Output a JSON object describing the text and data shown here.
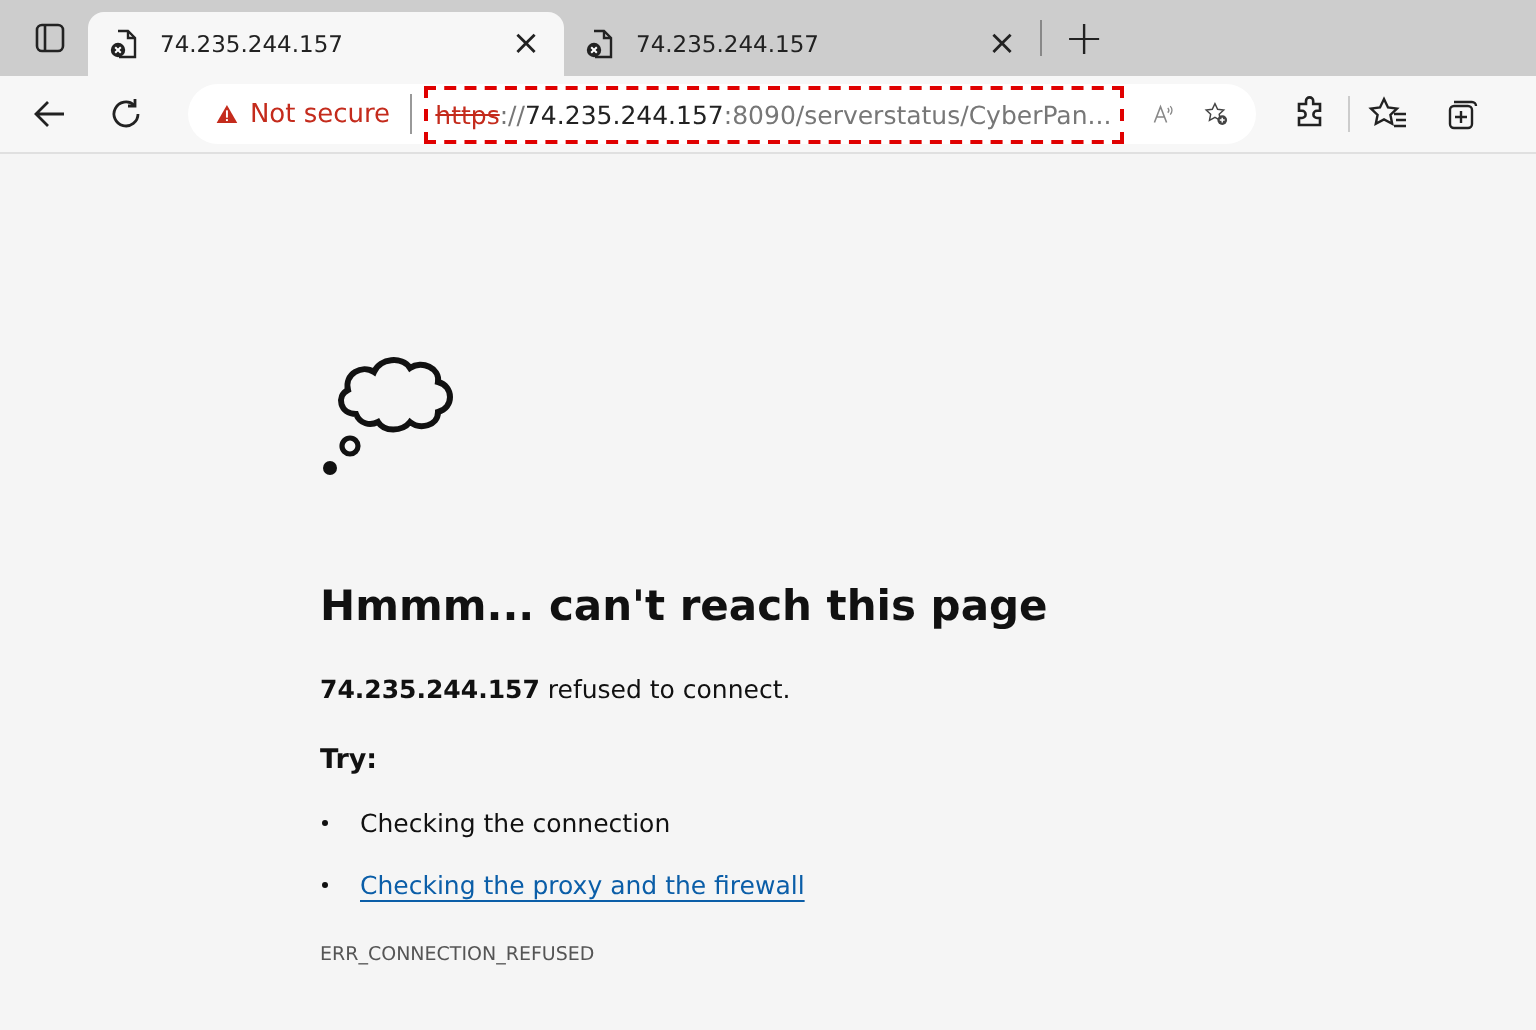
{
  "tabs": [
    {
      "title": "74.235.244.157",
      "selected": true,
      "close": "×"
    },
    {
      "title": "74.235.244.157",
      "selected": false,
      "close": "×"
    }
  ],
  "new_tab": "+",
  "address_bar": {
    "security": "Not secure",
    "scheme": "https",
    "separator": "://",
    "host": "74.235.244.157",
    "rest": ":8090/serverstatus/CyberPan...",
    "highlighted": true
  },
  "error": {
    "heading": "Hmmm... can't reach this page",
    "host": "74.235.244.157",
    "message": " refused to connect.",
    "try_label": "Try:",
    "suggestions": [
      {
        "kind": "text",
        "text": "Checking the connection"
      },
      {
        "kind": "link",
        "text": "Checking the proxy and the firewall"
      }
    ],
    "code": "ERR_CONNECTION_REFUSED"
  }
}
